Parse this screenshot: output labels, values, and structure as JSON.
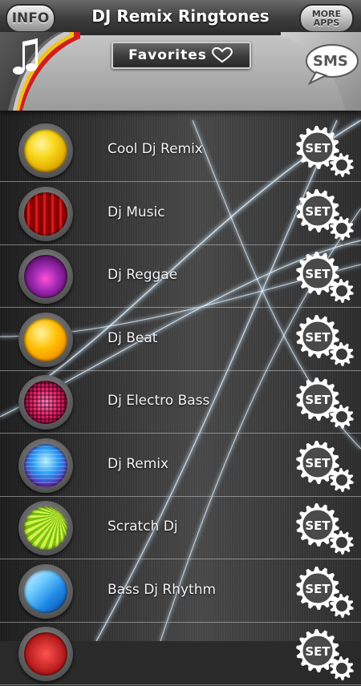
{
  "header": {
    "title": "DJ Remix Ringtones",
    "info_label": "INFO",
    "more_line1": "MORE",
    "more_line2": "APPS",
    "favorites_label": "Favorites",
    "sms_label": "SMS"
  },
  "set_label": "SET",
  "ringtones": [
    {
      "name": "Cool Dj Remix",
      "thumb": "yellow-swirl"
    },
    {
      "name": "Dj Music",
      "thumb": "red-curtain"
    },
    {
      "name": "Dj Reggae",
      "thumb": "purple-music-note"
    },
    {
      "name": "Dj Beat",
      "thumb": "orange-glow"
    },
    {
      "name": "Dj Electro Bass",
      "thumb": "pink-equalizer"
    },
    {
      "name": "Dj Remix",
      "thumb": "blue-disco-lights"
    },
    {
      "name": "Scratch Dj",
      "thumb": "green-rays"
    },
    {
      "name": "Bass Dj Rhythm",
      "thumb": "blue-waves"
    },
    {
      "name": "",
      "thumb": "red-partial"
    }
  ],
  "colors": {
    "header_bar": "#2b2b2b",
    "accent_red": "#c62828",
    "accent_yellow": "#f2c21b"
  }
}
